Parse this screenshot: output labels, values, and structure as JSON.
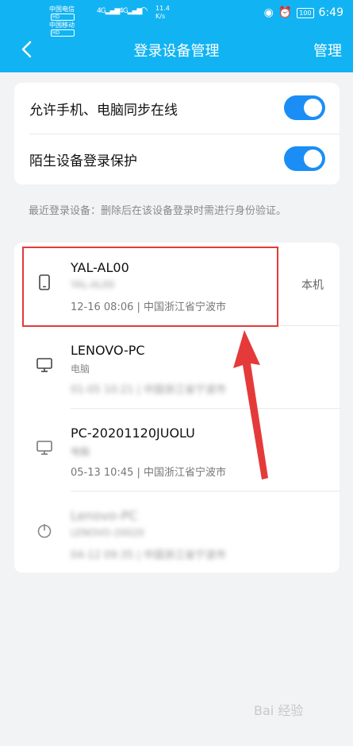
{
  "status_bar": {
    "carrier1": "中国电信",
    "carrier2": "中国移动",
    "hd": "HD",
    "signal1": "4G",
    "signal2": "4G",
    "speed_value": "11.4",
    "speed_unit": "K/s",
    "battery": "100",
    "time": "6:49"
  },
  "nav": {
    "title": "登录设备管理",
    "manage_label": "管理"
  },
  "settings": [
    {
      "label": "允许手机、电脑同步在线",
      "enabled": true
    },
    {
      "label": "陌生设备登录保护",
      "enabled": true
    }
  ],
  "hint": "最近登录设备：删除后在该设备登录时需进行身份验证。",
  "devices": [
    {
      "icon": "phone-icon",
      "name": "YAL-AL00",
      "type": "YAL-AL00",
      "meta": "12-16 08:06 | 中国浙江省宁波市",
      "badge": "本机"
    },
    {
      "icon": "monitor-icon",
      "name": "LENOVO-PC",
      "type": "电脑",
      "meta": "01-05 10:21 | 中国浙江省宁波市",
      "badge": ""
    },
    {
      "icon": "monitor-icon",
      "name": "PC-20201120JUOLU",
      "type": "电脑",
      "meta": "05-13 10:45 | 中国浙江省宁波市",
      "badge": ""
    },
    {
      "icon": "power-icon",
      "name": "Lenovo-PC",
      "type": "LENOVO-20020",
      "meta": "04-12 09:35 | 中国浙江省宁波市",
      "badge": ""
    }
  ],
  "watermark": "Bai 经验",
  "colors": {
    "header": "#12b3f2",
    "toggle": "#1a8ef5",
    "highlight": "#e53a3a"
  }
}
